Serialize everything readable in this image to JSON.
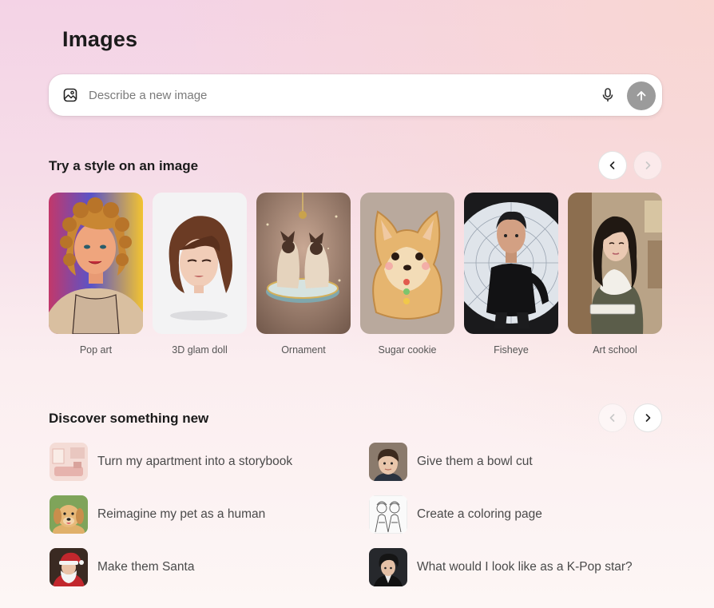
{
  "page": {
    "title": "Images"
  },
  "search": {
    "placeholder": "Describe a new image",
    "value": ""
  },
  "styles_section": {
    "title": "Try a style on an image",
    "items": [
      {
        "label": "Pop art"
      },
      {
        "label": "3D glam doll"
      },
      {
        "label": "Ornament"
      },
      {
        "label": "Sugar cookie"
      },
      {
        "label": "Fisheye"
      },
      {
        "label": "Art school"
      }
    ]
  },
  "discover_section": {
    "title": "Discover something new",
    "items": [
      {
        "label": "Turn my apartment into a storybook"
      },
      {
        "label": "Give them a bowl cut"
      },
      {
        "label": "Reimagine my pet as a human"
      },
      {
        "label": "Create a coloring page"
      },
      {
        "label": "Make them Santa"
      },
      {
        "label": "What would I look like as a K-Pop star?"
      }
    ]
  }
}
